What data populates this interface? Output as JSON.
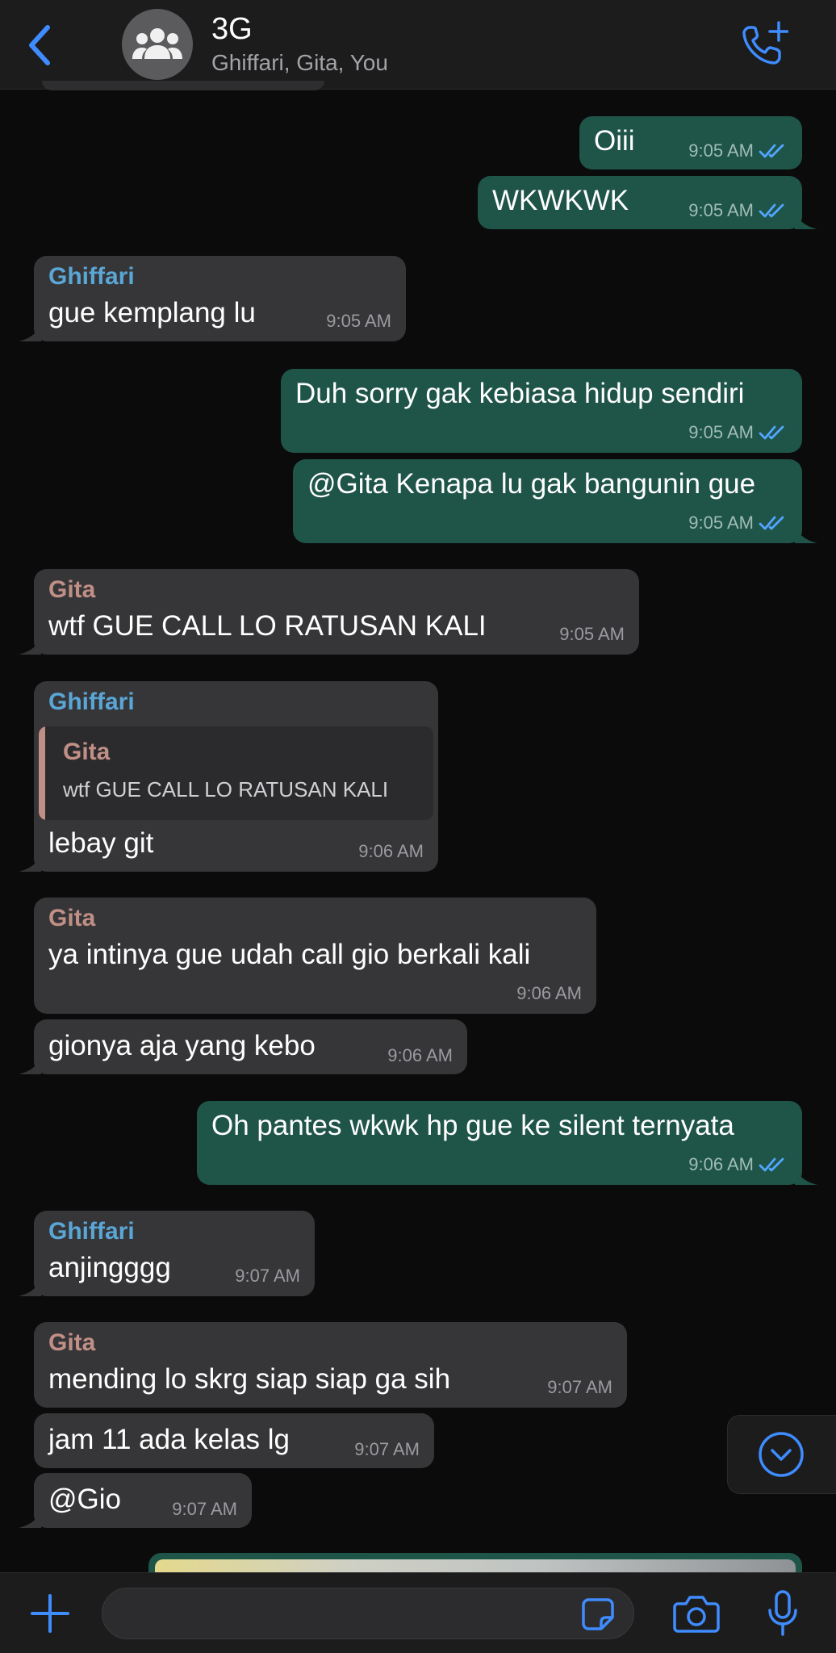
{
  "header": {
    "title": "3G",
    "subtitle": "Ghiffari, Gita, You",
    "back_icon": "chevron-left-icon",
    "call_icon": "add-call-icon",
    "accent_color": "#3f8cff"
  },
  "messages": [
    {
      "direction": "out",
      "text": "Oiii",
      "time": "9:05 AM",
      "status": "read"
    },
    {
      "direction": "out",
      "text": "WKWKWK",
      "time": "9:05 AM",
      "status": "read"
    },
    {
      "direction": "in",
      "sender": "Ghiffari",
      "text": "gue kemplang lu",
      "time": "9:05 AM"
    },
    {
      "direction": "out",
      "text": "Duh sorry gak kebiasa hidup sendiri",
      "time": "9:05 AM",
      "status": "read"
    },
    {
      "direction": "out",
      "text": "@Gita Kenapa lu gak bangunin gue",
      "time": "9:05 AM",
      "status": "read"
    },
    {
      "direction": "in",
      "sender": "Gita",
      "text": "wtf GUE CALL LO RATUSAN KALI",
      "time": "9:05 AM"
    },
    {
      "direction": "in",
      "sender": "Ghiffari",
      "quote": {
        "sender": "Gita",
        "text": "wtf GUE CALL LO RATUSAN KALI"
      },
      "text": "lebay git",
      "time": "9:06 AM"
    },
    {
      "direction": "in",
      "sender": "Gita",
      "text": "ya intinya gue udah call gio berkali kali",
      "time": "9:06 AM"
    },
    {
      "direction": "in",
      "text": "gionya aja yang kebo",
      "time": "9:06 AM"
    },
    {
      "direction": "out",
      "text": "Oh pantes wkwk hp gue ke silent ternyata",
      "time": "9:06 AM",
      "status": "read"
    },
    {
      "direction": "in",
      "sender": "Ghiffari",
      "text": "anjingggg",
      "time": "9:07 AM"
    },
    {
      "direction": "in",
      "sender": "Gita",
      "text": "mending lo skrg siap siap ga sih",
      "time": "9:07 AM"
    },
    {
      "direction": "in",
      "text": "jam 11 ada kelas lg",
      "time": "9:07 AM"
    },
    {
      "direction": "in",
      "text": "@Gio",
      "time": "9:07 AM"
    }
  ],
  "colors": {
    "incoming_bubble": "#363638",
    "outgoing_bubble": "#1f5448",
    "ghiffari_name": "#5aa6d6",
    "gita_name": "#c08f86",
    "read_ticks": "#53a6ff"
  },
  "input_bar": {
    "placeholder": "",
    "value": "",
    "icons": [
      "plus-icon",
      "sticker-icon",
      "camera-icon",
      "microphone-icon"
    ]
  },
  "scroll_down_icon": "chevron-down-circle-icon"
}
